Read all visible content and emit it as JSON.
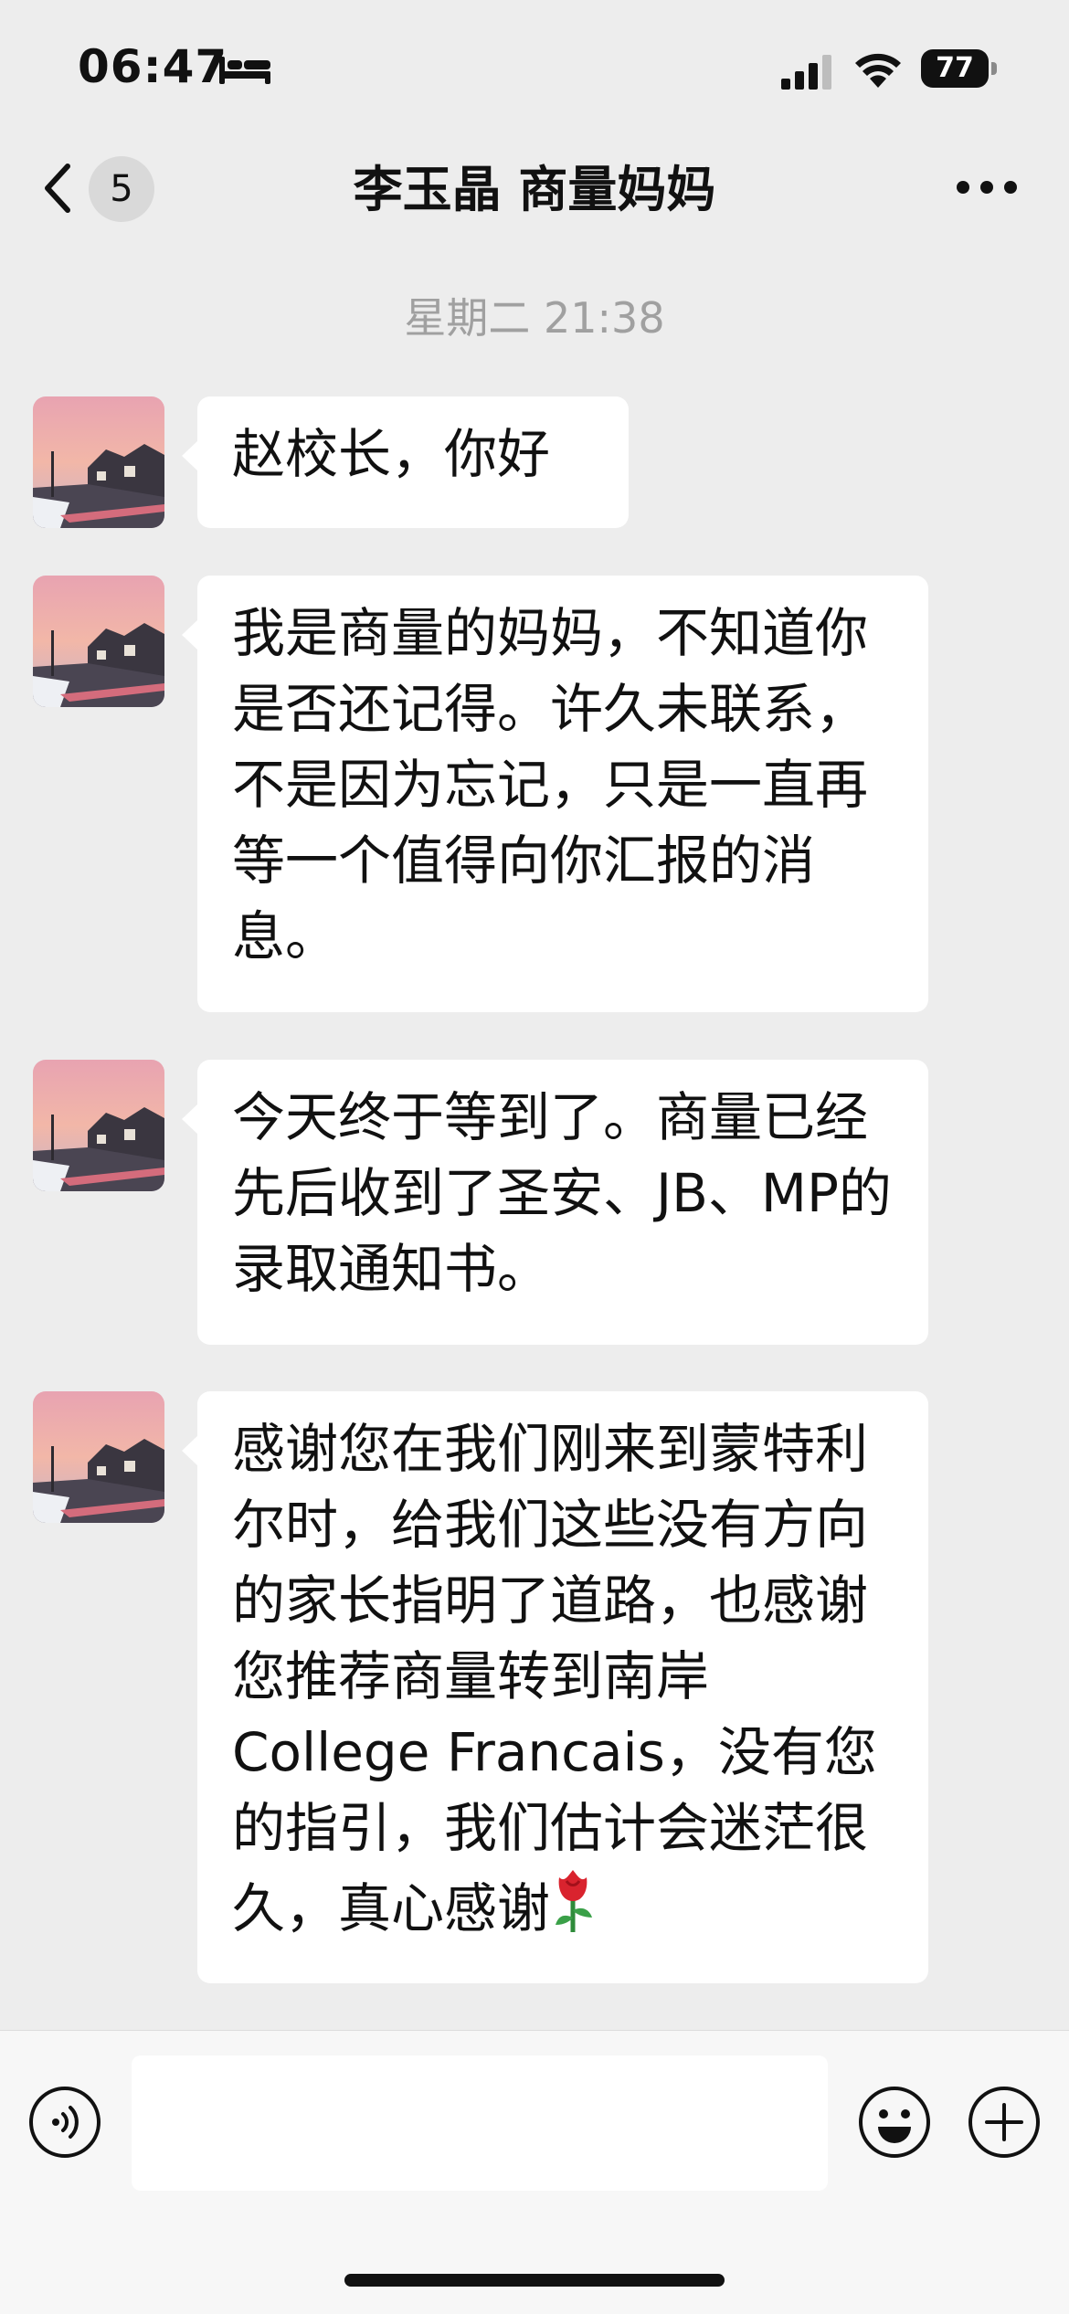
{
  "status_bar": {
    "time": "06:47",
    "battery": "77"
  },
  "nav": {
    "unread_count": "5",
    "title": "李玉晶 商量妈妈"
  },
  "chat": {
    "timestamp": "星期二 21:38",
    "messages": [
      {
        "text": "赵校长，你好"
      },
      {
        "text": "我是商量的妈妈，不知道你是否还记得。许久未联系，不是因为忘记，只是一直再等一个值得向你汇报的消息。"
      },
      {
        "text": "今天终于等到了。商量已经先后收到了圣安、JB、MP的录取通知书。"
      },
      {
        "text": "感谢您在我们刚来到蒙特利尔时，给我们这些没有方向的家长指明了道路，也感谢您推荐商量转到南岸College Francais，没有您的指引，我们估计会迷茫很久，真心感谢"
      }
    ]
  },
  "input_bar": {
    "value": "",
    "placeholder": ""
  },
  "icons": {
    "back": "chevron-left-icon",
    "more": "more-dots-icon",
    "voice": "voice-icon",
    "emoji": "emoji-icon",
    "plus": "plus-icon",
    "rose": "rose-emoji"
  },
  "colors": {
    "background": "#ededed",
    "bubble": "#ffffff",
    "input_bar": "#f7f7f7",
    "timestamp": "#a0a0a0"
  }
}
